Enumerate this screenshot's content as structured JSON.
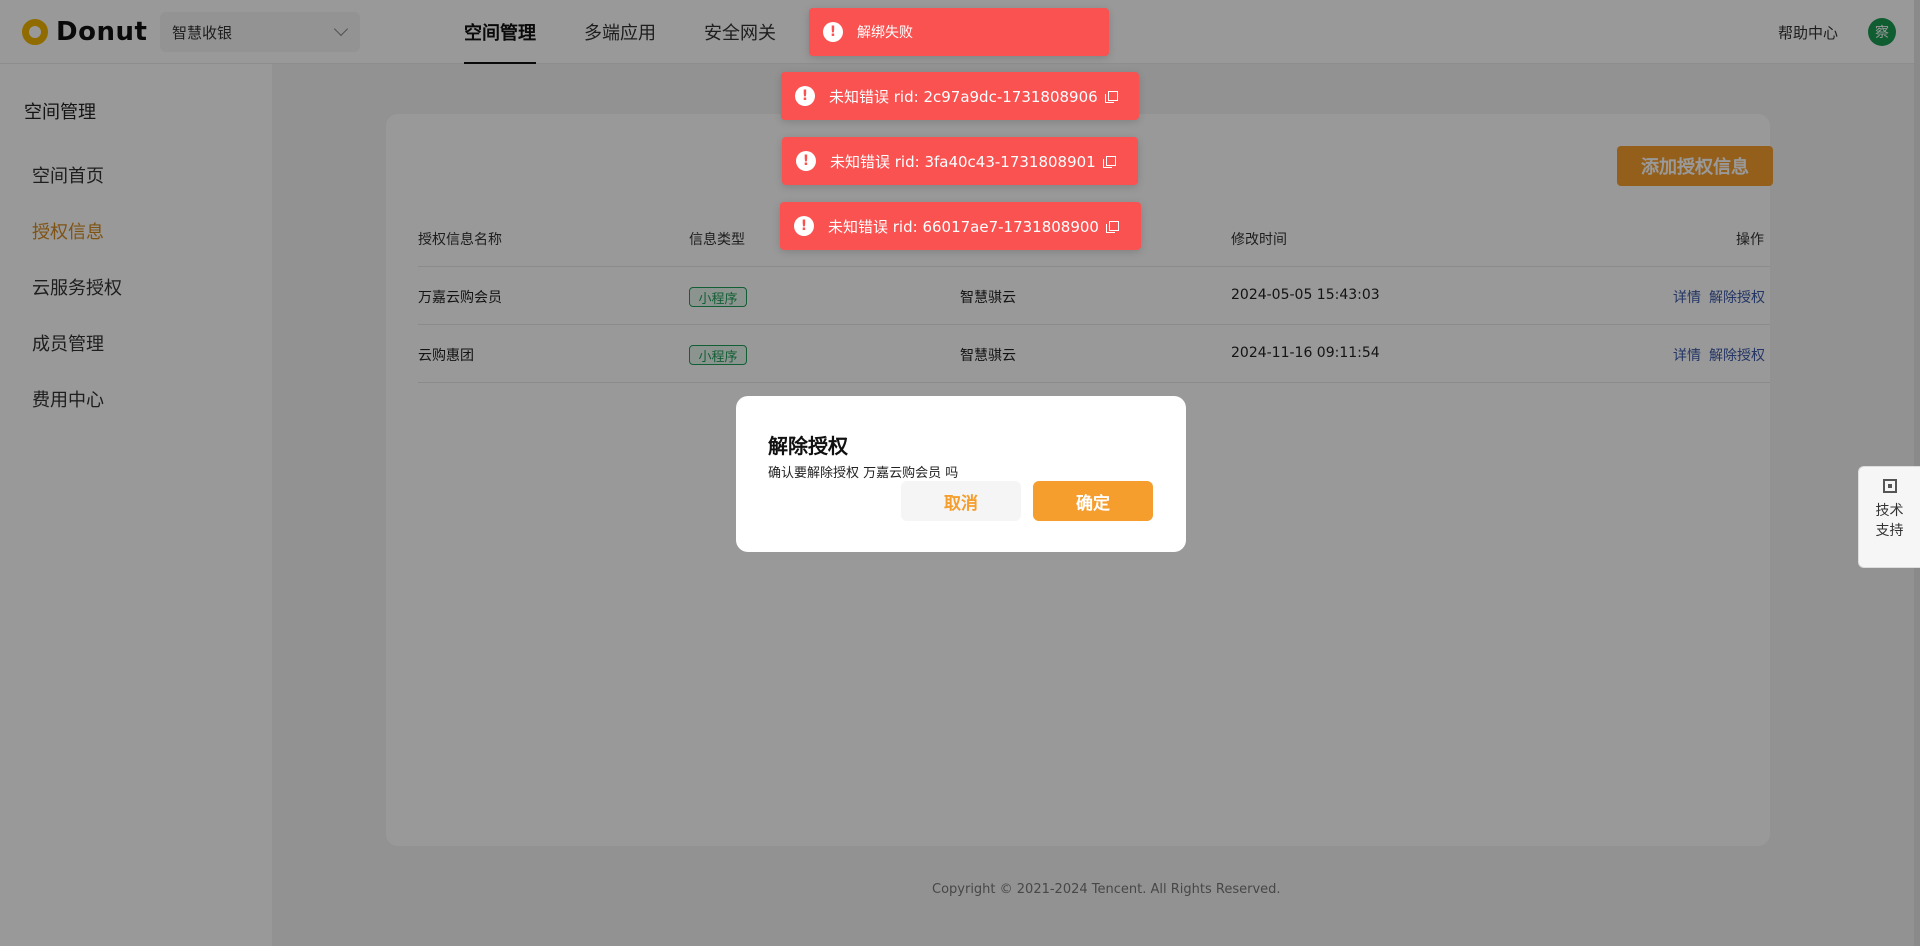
{
  "header": {
    "logo_text": "Donut",
    "space_select": "智慧收银",
    "tabs": [
      "空间管理",
      "多端应用",
      "安全网关"
    ],
    "help": "帮助中心",
    "avatar": "察"
  },
  "sidebar": {
    "title": "空间管理",
    "items": [
      "空间首页",
      "授权信息",
      "云服务授权",
      "成员管理",
      "费用中心"
    ],
    "active_index": 1
  },
  "main": {
    "add_button": "添加授权信息",
    "columns": [
      "授权信息名称",
      "信息类型",
      "",
      "修改时间",
      "操作"
    ],
    "rows": [
      {
        "name": "万嘉云购会员",
        "type": "小程序",
        "owner": "智慧骐云",
        "modified": "2024-05-05 15:43:03",
        "detail": "详情",
        "unbind": "解除授权"
      },
      {
        "name": "云购惠团",
        "type": "小程序",
        "owner": "智慧骐云",
        "modified": "2024-11-16 09:11:54",
        "detail": "详情",
        "unbind": "解除授权"
      }
    ]
  },
  "footer": {
    "copyright": "Copyright © 2021-2024 Tencent. All Rights Reserved."
  },
  "support": {
    "line1": "技术",
    "line2": "支持"
  },
  "dialog": {
    "title": "解除授权",
    "message": "确认要解除授权 万嘉云购会员 吗",
    "cancel": "取消",
    "ok": "确定"
  },
  "toasts": [
    "解绑失败",
    "未知错误 rid: 2c97a9dc-1731808906",
    "未知错误 rid: 3fa40c43-1731808901",
    "未知错误 rid: 66017ae7-1731808900"
  ],
  "colors": {
    "accent": "#f59e2e",
    "error": "#fa5151",
    "tag_green": "#1e9e5a",
    "link": "#3d5aa9"
  }
}
